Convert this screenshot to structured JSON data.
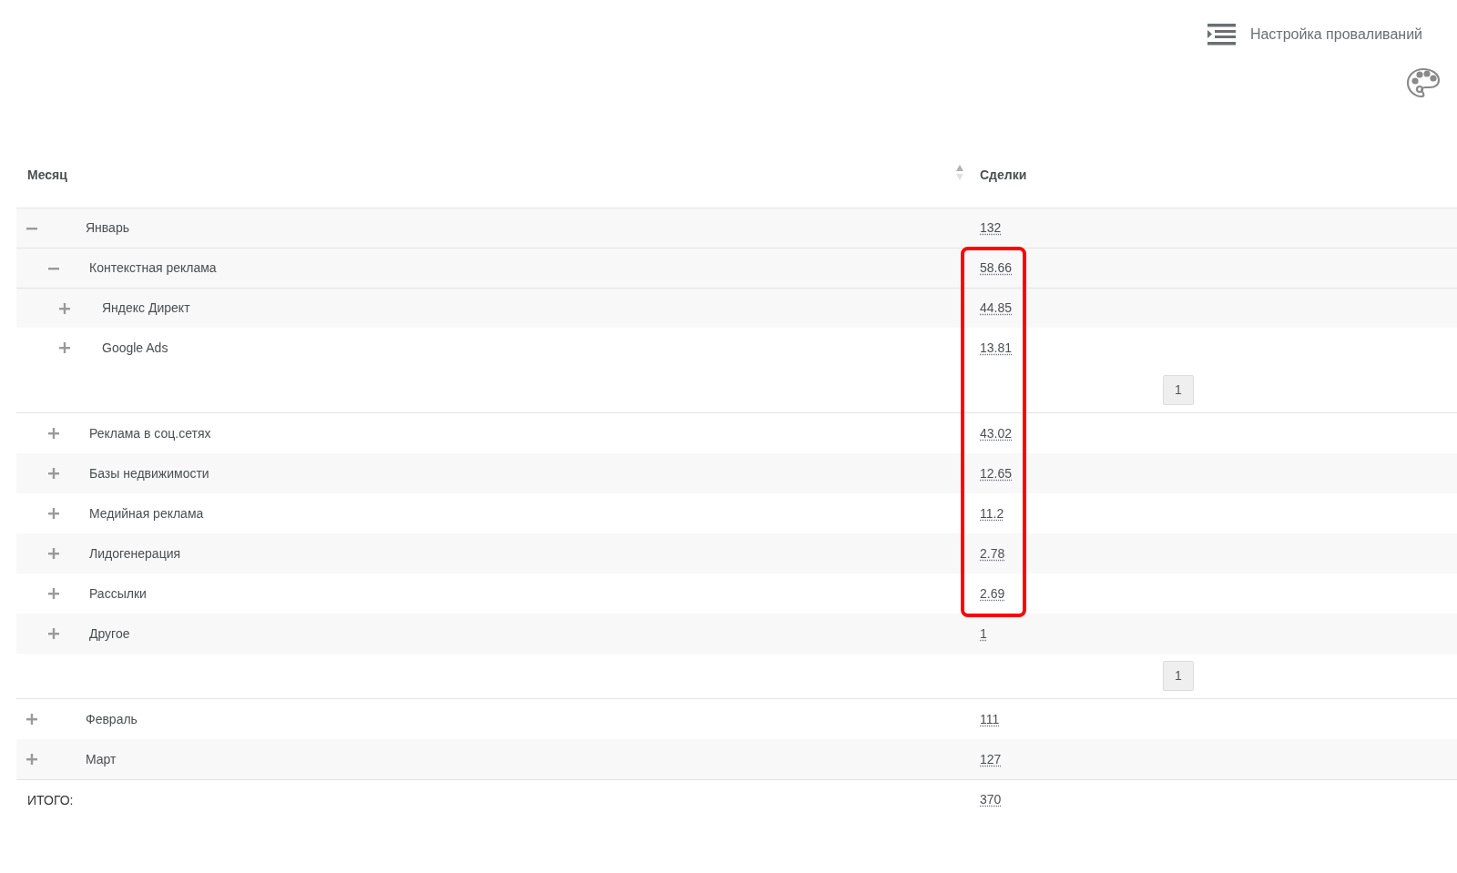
{
  "toolbar": {
    "drilldown_settings": "Настройка проваливаний"
  },
  "table": {
    "columns": [
      "Месяц",
      "Сделки"
    ],
    "rows": [
      {
        "label": "Январь",
        "value": "132",
        "expanded": true,
        "pager": "1",
        "children": [
          {
            "label": "Контекстная реклама",
            "value": "58.66",
            "expanded": true,
            "pager": "1",
            "children": [
              {
                "label": "Яндекс Директ",
                "value": "44.85",
                "expanded": false
              },
              {
                "label": "Google Ads",
                "value": "13.81",
                "expanded": false
              }
            ]
          },
          {
            "label": "Реклама в соц.сетях",
            "value": "43.02",
            "expanded": false
          },
          {
            "label": "Базы недвижимости",
            "value": "12.65",
            "expanded": false
          },
          {
            "label": "Медийная реклама",
            "value": "11.2",
            "expanded": false
          },
          {
            "label": "Лидогенерация",
            "value": "2.78",
            "expanded": false
          },
          {
            "label": "Рассылки",
            "value": "2.69",
            "expanded": false
          },
          {
            "label": "Другое",
            "value": "1",
            "expanded": false
          }
        ]
      },
      {
        "label": "Февраль",
        "value": "111",
        "expanded": false
      },
      {
        "label": "Март",
        "value": "127",
        "expanded": false
      }
    ],
    "total": {
      "label": "ИТОГО:",
      "value": "370"
    }
  }
}
